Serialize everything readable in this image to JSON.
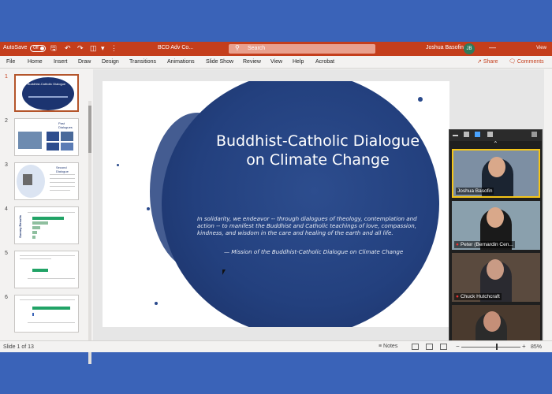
{
  "titlebar": {
    "autosave_label": "AutoSave",
    "autosave_state": "Off",
    "doc_title": "BCD Adv Co...",
    "search_placeholder": "Search",
    "user_name": "Joshua Basofin",
    "user_initials": "JB",
    "view_label": "View"
  },
  "menu": [
    "File",
    "Home",
    "Insert",
    "Draw",
    "Design",
    "Transitions",
    "Animations",
    "Slide Show",
    "Review",
    "View",
    "Help",
    "Acrobat"
  ],
  "share_label": "Share",
  "comments_label": "Comments",
  "thumbnails": {
    "numbers": [
      "1",
      "2",
      "3",
      "4",
      "5",
      "6"
    ],
    "slide2_label": "Past Dialogues",
    "slide3_label": "Second Dialogue",
    "slide4_vertical": "Survey Results"
  },
  "slide": {
    "title_line1": "Buddhist-Catholic Dialogue",
    "title_line2": "on Climate Change",
    "body": "In solidarity, we endeavor -- through dialogues of theology, contemplation and action -- to manifest the Buddhist and Catholic teachings of love, compassion, kindness, and wisdom in the care and healing of the earth and all life.",
    "attribution": "— Mission of the Buddhist-Catholic Dialogue on Climate Change"
  },
  "participants": [
    {
      "name": "Joshua Basofin",
      "muted": false,
      "active": true
    },
    {
      "name": "Peter (Bernardin Cen...",
      "muted": true,
      "active": false
    },
    {
      "name": "Chuck Hutchcraft",
      "muted": true,
      "active": false
    },
    {
      "name": "",
      "muted": false,
      "active": false
    }
  ],
  "status": {
    "slide_position": "Slide 1 of 13",
    "notes_label": "Notes",
    "zoom": "85%"
  },
  "colors": {
    "ribbon": "#c43e1c",
    "slide_blue": "#23407e",
    "background": "#3a63b8",
    "active_speaker": "#f5c518"
  }
}
